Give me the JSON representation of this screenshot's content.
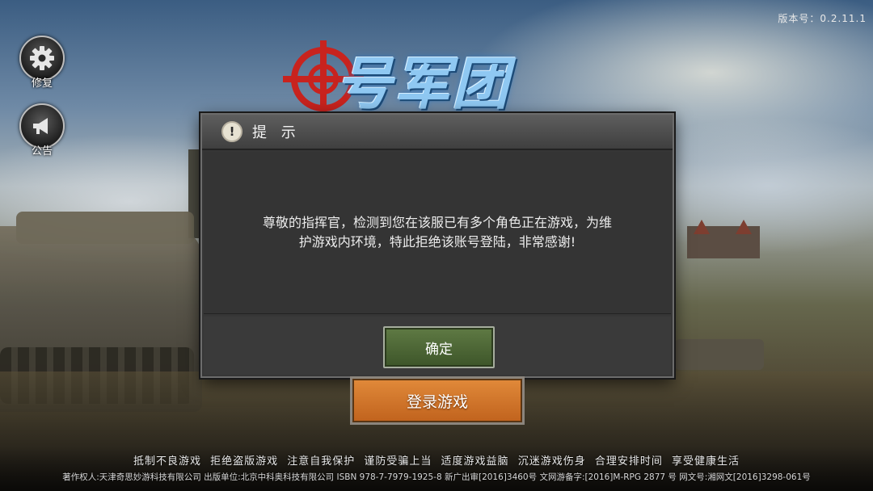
{
  "version": "版本号：0.2.11.1",
  "side_buttons": {
    "repair": {
      "label": "修复",
      "icon": "gear-icon"
    },
    "notice": {
      "label": "公告",
      "icon": "megaphone-icon"
    }
  },
  "logo": {
    "text": "号军团",
    "icon": "crosshair-icon"
  },
  "dialog": {
    "title": "提 示",
    "icon": "exclamation-icon",
    "message": "尊敬的指挥官，检测到您在该服已有多个角色正在游戏，为维护游戏内环境，特此拒绝该账号登陆，非常感谢!",
    "confirm_label": "确定"
  },
  "login_button": "登录游戏",
  "health_notice": "抵制不良游戏 拒绝盗版游戏 注意自我保护 谨防受骗上当 适度游戏益脑 沉迷游戏伤身 合理安排时间 享受健康生活",
  "copyright": "著作权人:天津奇思妙游科技有限公司 出版单位:北京中科奥科技有限公司 ISBN 978-7-7979-1925-8 新广出审[2016]3460号 文网游备字:[2016]M-RPG 2877 号 网文号:湘网文[2016]3298-061号",
  "colors": {
    "accent_green": "#4e6a36",
    "accent_orange": "#d2742a",
    "logo_blue": "#8fc8f2",
    "crosshair_red": "#c8231e"
  }
}
